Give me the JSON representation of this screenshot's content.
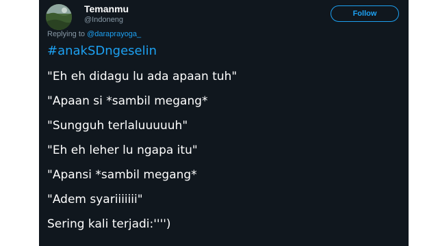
{
  "tweet": {
    "display_name": "Temanmu",
    "username": "@Indoneng",
    "follow_label": "Follow",
    "replying_prefix": "Replying to",
    "replying_to": "@daraprayoga_",
    "hashtag": "#anakSDngeselin",
    "lines": [
      "\"Eh eh didagu lu ada apaan tuh\"",
      "\"Apaan si *sambil megang*",
      "\"Sungguh terlaluuuuuh\"",
      "\"Eh eh leher lu ngapa itu\"",
      "\"Apansi *sambil megang*",
      "\"Adem syariiiiiii\"",
      "Sering kali terjadi:'''')"
    ]
  },
  "colors": {
    "background": "#10171e",
    "accent": "#1da1f2",
    "text": "#ffffff",
    "muted": "#8899a6"
  },
  "icons": {
    "avatar": "profile-photo"
  }
}
